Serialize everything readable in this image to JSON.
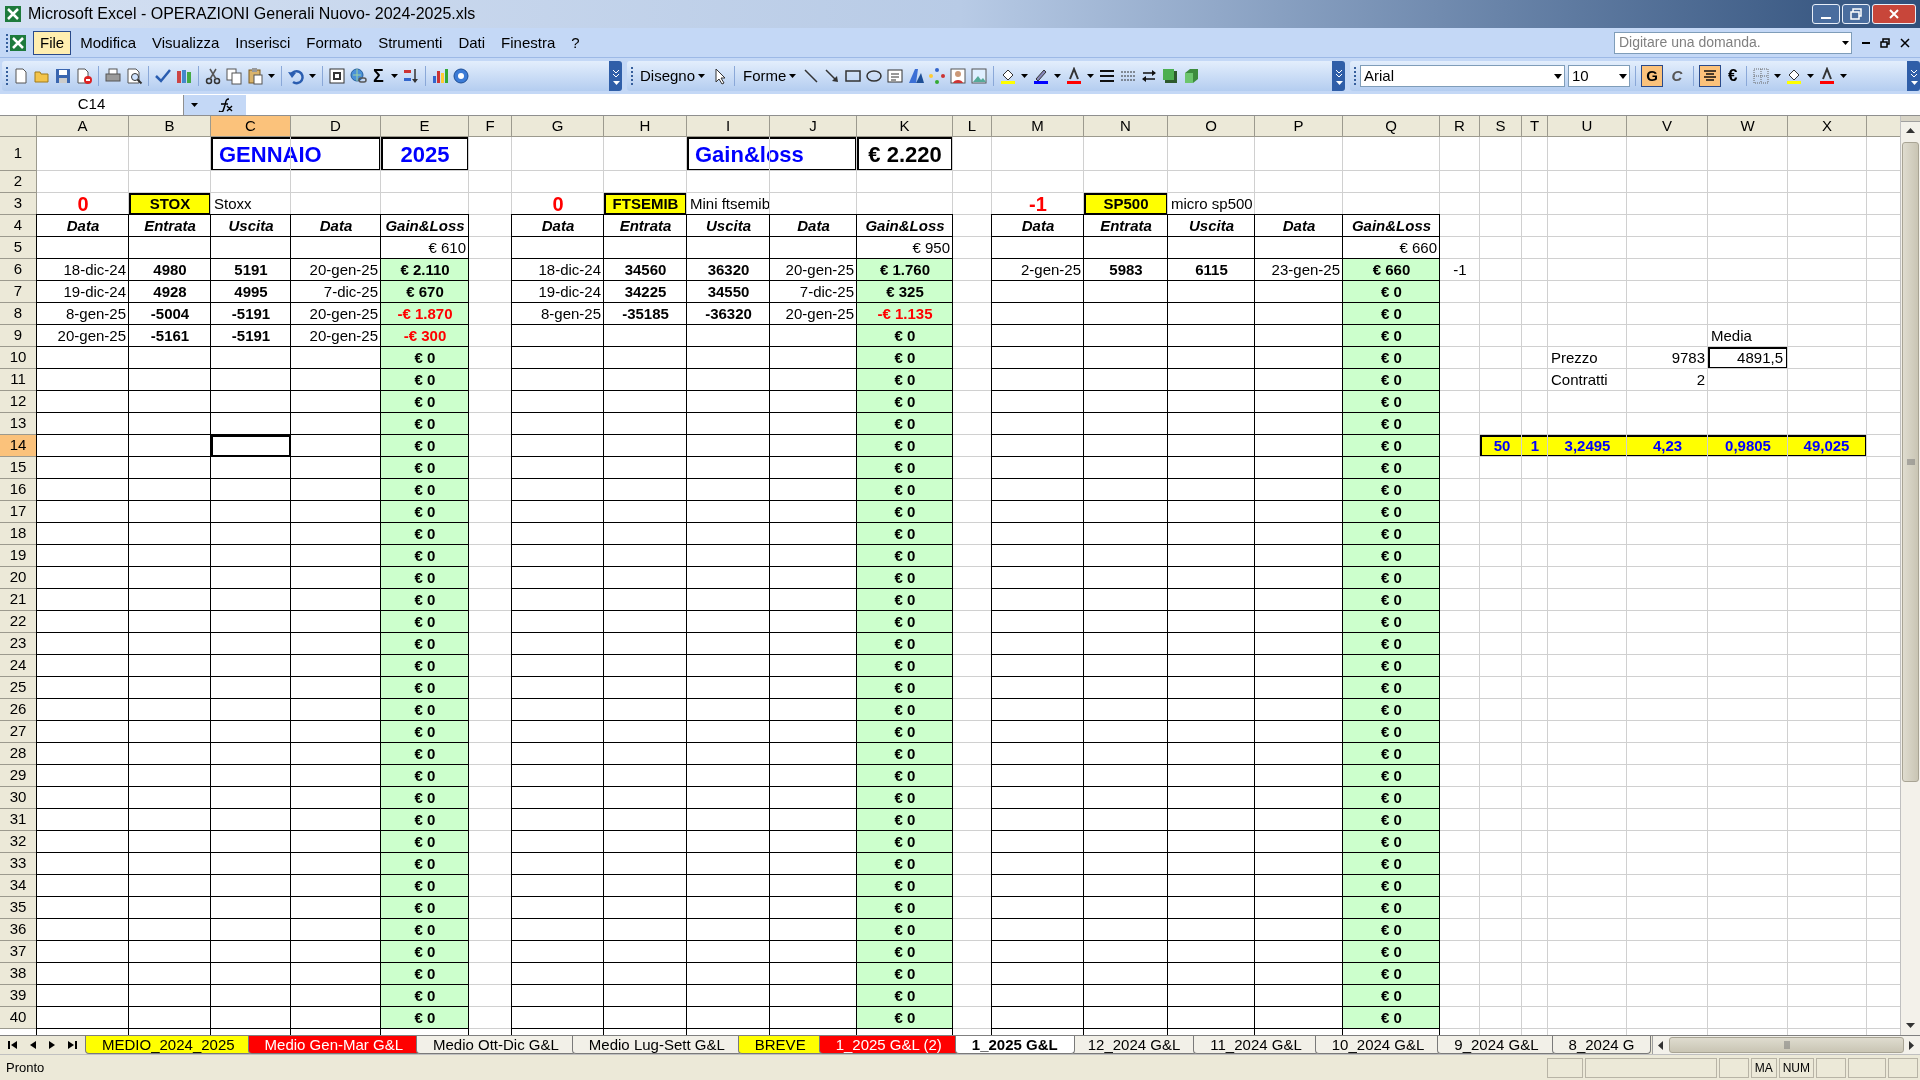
{
  "window": {
    "title": "Microsoft Excel - OPERAZIONI Generali Nuovo- 2024-2025.xls"
  },
  "menu": [
    {
      "label": "File",
      "selected": true
    },
    {
      "label": "Modifica",
      "selected": false
    },
    {
      "label": "Visualizza",
      "selected": false
    },
    {
      "label": "Inserisci",
      "selected": false
    },
    {
      "label": "Formato",
      "selected": false
    },
    {
      "label": "Strumenti",
      "selected": false
    },
    {
      "label": "Dati",
      "selected": false
    },
    {
      "label": "Finestra",
      "selected": false
    },
    {
      "label": "?",
      "selected": false
    }
  ],
  "help_box": {
    "placeholder": "Digitare una domanda."
  },
  "toolbar": {
    "sum": "Σ",
    "drawing_menu": "Disegno",
    "shapes_menu": "Forme",
    "font": "Arial",
    "size": "10",
    "bold": {
      "label": "G",
      "on": true
    },
    "italic": {
      "label": "C",
      "on": false
    },
    "center_align": {
      "on": true
    },
    "euro": "€"
  },
  "formula_bar": {
    "name_box": "C14"
  },
  "sheet": {
    "columns": [
      {
        "label": "A",
        "selected": false
      },
      {
        "label": "B",
        "selected": false
      },
      {
        "label": "C",
        "selected": true
      },
      {
        "label": "D",
        "selected": false
      },
      {
        "label": "E",
        "selected": false
      },
      {
        "label": "F",
        "selected": false
      },
      {
        "label": "G",
        "selected": false
      },
      {
        "label": "H",
        "selected": false
      },
      {
        "label": "I",
        "selected": false
      },
      {
        "label": "J",
        "selected": false
      },
      {
        "label": "K",
        "selected": false
      },
      {
        "label": "L",
        "selected": false
      },
      {
        "label": "M",
        "selected": false
      },
      {
        "label": "N",
        "selected": false
      },
      {
        "label": "O",
        "selected": false
      },
      {
        "label": "P",
        "selected": false
      },
      {
        "label": "Q",
        "selected": false
      },
      {
        "label": "R",
        "selected": false
      },
      {
        "label": "S",
        "selected": false
      },
      {
        "label": "T",
        "selected": false
      },
      {
        "label": "U",
        "selected": false
      },
      {
        "label": "V",
        "selected": false
      },
      {
        "label": "W",
        "selected": false
      },
      {
        "label": "X",
        "selected": false
      }
    ],
    "rows": [
      {
        "label": "1",
        "selected": false,
        "cells": [
          null,
          null,
          {
            "text": "GENNAIO",
            "kind": "merged_title"
          },
          null,
          {
            "text": "2025",
            "kind": "title"
          },
          null,
          null,
          null,
          {
            "text": "Gain&loss",
            "kind": "merged_title"
          },
          null,
          {
            "text": "€ 2.220",
            "kind": "total"
          }
        ]
      },
      {
        "label": "2",
        "selected": false
      },
      {
        "label": "3",
        "selected": false,
        "cells": [
          {
            "text": "0",
            "kind": "count"
          },
          {
            "text": "STOX",
            "kind": "tag"
          },
          {
            "text": "Stoxx",
            "kind": "note"
          },
          null,
          null,
          null,
          {
            "text": "0",
            "kind": "count"
          },
          {
            "text": "FTSEMIB",
            "kind": "tag"
          },
          {
            "text": "Mini ftsemib",
            "kind": "note"
          },
          null,
          null,
          null,
          {
            "text": "-1",
            "kind": "count"
          },
          {
            "text": "SP500",
            "kind": "tag"
          },
          {
            "text": "micro sp500",
            "kind": "note"
          }
        ]
      },
      {
        "label": "4",
        "selected": false,
        "cells": [
          {
            "text": "Data",
            "kind": "header"
          },
          {
            "text": "Entrata",
            "kind": "header"
          },
          {
            "text": "Uscita",
            "kind": "header"
          },
          {
            "text": "Data",
            "kind": "header"
          },
          {
            "text": "Gain&Loss",
            "kind": "header"
          },
          null,
          {
            "text": "Data",
            "kind": "header"
          },
          {
            "text": "Entrata",
            "kind": "header"
          },
          {
            "text": "Uscita",
            "kind": "header"
          },
          {
            "text": "Data",
            "kind": "header"
          },
          {
            "text": "Gain&Loss",
            "kind": "header"
          },
          null,
          {
            "text": "Data",
            "kind": "header"
          },
          {
            "text": "Entrata",
            "kind": "header"
          },
          {
            "text": "Uscita",
            "kind": "header"
          },
          {
            "text": "Data",
            "kind": "header"
          },
          {
            "text": "Gain&Loss",
            "kind": "header"
          }
        ]
      },
      {
        "label": "5",
        "selected": false,
        "cells": [
          null,
          null,
          null,
          null,
          {
            "text": "€ 610",
            "kind": "sum"
          },
          null,
          null,
          null,
          null,
          null,
          {
            "text": "€ 950",
            "kind": "sum"
          },
          null,
          null,
          null,
          null,
          null,
          {
            "text": "€ 660",
            "kind": "sum"
          }
        ]
      },
      {
        "label": "6",
        "selected": false,
        "cells": [
          {
            "text": "18-dic-24",
            "kind": "date"
          },
          {
            "text": "4980",
            "kind": "num"
          },
          {
            "text": "5191",
            "kind": "num"
          },
          {
            "text": "20-gen-25",
            "kind": "date"
          },
          {
            "text": "€ 2.110",
            "kind": "gain"
          },
          null,
          {
            "text": "18-dic-24",
            "kind": "date"
          },
          {
            "text": "34560",
            "kind": "num"
          },
          {
            "text": "36320",
            "kind": "num"
          },
          {
            "text": "20-gen-25",
            "kind": "date"
          },
          {
            "text": "€ 1.760",
            "kind": "gain"
          },
          null,
          {
            "text": "2-gen-25",
            "kind": "date"
          },
          {
            "text": "5983",
            "kind": "num"
          },
          {
            "text": "6115",
            "kind": "num"
          },
          {
            "text": "23-gen-25",
            "kind": "date"
          },
          {
            "text": "€ 660",
            "kind": "gain"
          },
          {
            "text": "-1",
            "kind": "plain_center"
          }
        ]
      },
      {
        "label": "7",
        "selected": false,
        "cells": [
          {
            "text": "19-dic-24",
            "kind": "date"
          },
          {
            "text": "4928",
            "kind": "num"
          },
          {
            "text": "4995",
            "kind": "num"
          },
          {
            "text": "7-dic-25",
            "kind": "date"
          },
          {
            "text": "€ 670",
            "kind": "gain"
          },
          null,
          {
            "text": "19-dic-24",
            "kind": "date"
          },
          {
            "text": "34225",
            "kind": "num"
          },
          {
            "text": "34550",
            "kind": "num"
          },
          {
            "text": "7-dic-25",
            "kind": "date"
          },
          {
            "text": "€ 325",
            "kind": "gain"
          },
          null,
          null,
          null,
          null,
          null,
          {
            "text": "€ 0",
            "kind": "gain"
          }
        ]
      },
      {
        "label": "8",
        "selected": false,
        "cells": [
          {
            "text": "8-gen-25",
            "kind": "date"
          },
          {
            "text": "-5004",
            "kind": "num"
          },
          {
            "text": "-5191",
            "kind": "num"
          },
          {
            "text": "20-gen-25",
            "kind": "date"
          },
          {
            "text": "-€ 1.870",
            "kind": "loss"
          },
          null,
          {
            "text": "8-gen-25",
            "kind": "date"
          },
          {
            "text": "-35185",
            "kind": "num"
          },
          {
            "text": "-36320",
            "kind": "num"
          },
          {
            "text": "20-gen-25",
            "kind": "date"
          },
          {
            "text": "-€ 1.135",
            "kind": "loss"
          },
          null,
          null,
          null,
          null,
          null,
          {
            "text": "€ 0",
            "kind": "gain"
          }
        ]
      },
      {
        "label": "9",
        "selected": false,
        "cells": [
          {
            "text": "20-gen-25",
            "kind": "date"
          },
          {
            "text": "-5161",
            "kind": "num"
          },
          {
            "text": "-5191",
            "kind": "num"
          },
          {
            "text": "20-gen-25",
            "kind": "date"
          },
          {
            "text": "-€ 300",
            "kind": "loss"
          },
          null,
          null,
          null,
          null,
          null,
          {
            "text": "€ 0",
            "kind": "gain"
          },
          null,
          null,
          null,
          null,
          null,
          {
            "text": "€ 0",
            "kind": "gain"
          },
          null,
          null,
          null,
          null,
          null,
          {
            "text": "Media",
            "kind": "note"
          }
        ]
      },
      {
        "label": "10",
        "selected": false,
        "cells": [
          null,
          null,
          null,
          null,
          {
            "text": "€ 0",
            "kind": "gain"
          },
          null,
          null,
          null,
          null,
          null,
          {
            "text": "€ 0",
            "kind": "gain"
          },
          null,
          null,
          null,
          null,
          null,
          {
            "text": "€ 0",
            "kind": "gain"
          },
          null,
          null,
          null,
          {
            "text": "Prezzo",
            "kind": "note"
          },
          {
            "text": "9783",
            "kind": "value"
          },
          {
            "text": "4891,5",
            "kind": "boxed"
          }
        ]
      },
      {
        "label": "11",
        "selected": false,
        "cells": [
          null,
          null,
          null,
          null,
          {
            "text": "€ 0",
            "kind": "gain"
          },
          null,
          null,
          null,
          null,
          null,
          {
            "text": "€ 0",
            "kind": "gain"
          },
          null,
          null,
          null,
          null,
          null,
          {
            "text": "€ 0",
            "kind": "gain"
          },
          null,
          null,
          null,
          {
            "text": "Contratti",
            "kind": "note"
          },
          {
            "text": "2",
            "kind": "value"
          }
        ]
      },
      {
        "label": "12",
        "selected": false,
        "cells": [
          null,
          null,
          null,
          null,
          {
            "text": "€ 0",
            "kind": "gain"
          },
          null,
          null,
          null,
          null,
          null,
          {
            "text": "€ 0",
            "kind": "gain"
          },
          null,
          null,
          null,
          null,
          null,
          {
            "text": "€ 0",
            "kind": "gain"
          }
        ]
      },
      {
        "label": "13",
        "selected": false,
        "cells": [
          null,
          null,
          null,
          null,
          {
            "text": "€ 0",
            "kind": "gain"
          },
          null,
          null,
          null,
          null,
          null,
          {
            "text": "€ 0",
            "kind": "gain"
          },
          null,
          null,
          null,
          null,
          null,
          {
            "text": "€ 0",
            "kind": "gain"
          }
        ]
      },
      {
        "label": "14",
        "selected": true,
        "cells": [
          null,
          null,
          null,
          null,
          {
            "text": "€ 0",
            "kind": "gain"
          },
          null,
          null,
          null,
          null,
          null,
          {
            "text": "€ 0",
            "kind": "gain"
          },
          null,
          null,
          null,
          null,
          null,
          {
            "text": "€ 0",
            "kind": "gain"
          },
          null,
          {
            "text": "50",
            "kind": "highlight"
          },
          {
            "text": "1",
            "kind": "highlight"
          },
          {
            "text": "3,2495",
            "kind": "highlight"
          },
          {
            "text": "4,23",
            "kind": "highlight"
          },
          {
            "text": "0,9805",
            "kind": "highlight"
          },
          {
            "text": "49,025",
            "kind": "highlight"
          }
        ]
      },
      {
        "label": "15",
        "selected": false,
        "cells": [
          null,
          null,
          null,
          null,
          {
            "text": "€ 0",
            "kind": "gain"
          },
          null,
          null,
          null,
          null,
          null,
          {
            "text": "€ 0",
            "kind": "gain"
          },
          null,
          null,
          null,
          null,
          null,
          {
            "text": "€ 0",
            "kind": "gain"
          }
        ]
      },
      {
        "label": "16",
        "selected": false,
        "cells": [
          null,
          null,
          null,
          null,
          {
            "text": "€ 0",
            "kind": "gain"
          },
          null,
          null,
          null,
          null,
          null,
          {
            "text": "€ 0",
            "kind": "gain"
          },
          null,
          null,
          null,
          null,
          null,
          {
            "text": "€ 0",
            "kind": "gain"
          }
        ]
      },
      {
        "label": "17",
        "selected": false,
        "cells": [
          null,
          null,
          null,
          null,
          {
            "text": "€ 0",
            "kind": "gain"
          },
          null,
          null,
          null,
          null,
          null,
          {
            "text": "€ 0",
            "kind": "gain"
          },
          null,
          null,
          null,
          null,
          null,
          {
            "text": "€ 0",
            "kind": "gain"
          }
        ]
      },
      {
        "label": "18",
        "selected": false,
        "cells": [
          null,
          null,
          null,
          null,
          {
            "text": "€ 0",
            "kind": "gain"
          },
          null,
          null,
          null,
          null,
          null,
          {
            "text": "€ 0",
            "kind": "gain"
          },
          null,
          null,
          null,
          null,
          null,
          {
            "text": "€ 0",
            "kind": "gain"
          }
        ]
      },
      {
        "label": "19",
        "selected": false,
        "cells": [
          null,
          null,
          null,
          null,
          {
            "text": "€ 0",
            "kind": "gain"
          },
          null,
          null,
          null,
          null,
          null,
          {
            "text": "€ 0",
            "kind": "gain"
          },
          null,
          null,
          null,
          null,
          null,
          {
            "text": "€ 0",
            "kind": "gain"
          }
        ]
      },
      {
        "label": "20",
        "selected": false,
        "cells": [
          null,
          null,
          null,
          null,
          {
            "text": "€ 0",
            "kind": "gain"
          },
          null,
          null,
          null,
          null,
          null,
          {
            "text": "€ 0",
            "kind": "gain"
          },
          null,
          null,
          null,
          null,
          null,
          {
            "text": "€ 0",
            "kind": "gain"
          }
        ]
      },
      {
        "label": "21",
        "selected": false,
        "cells": [
          null,
          null,
          null,
          null,
          {
            "text": "€ 0",
            "kind": "gain"
          },
          null,
          null,
          null,
          null,
          null,
          {
            "text": "€ 0",
            "kind": "gain"
          },
          null,
          null,
          null,
          null,
          null,
          {
            "text": "€ 0",
            "kind": "gain"
          }
        ]
      },
      {
        "label": "22",
        "selected": false,
        "cells": [
          null,
          null,
          null,
          null,
          {
            "text": "€ 0",
            "kind": "gain"
          },
          null,
          null,
          null,
          null,
          null,
          {
            "text": "€ 0",
            "kind": "gain"
          },
          null,
          null,
          null,
          null,
          null,
          {
            "text": "€ 0",
            "kind": "gain"
          }
        ]
      },
      {
        "label": "23",
        "selected": false,
        "cells": [
          null,
          null,
          null,
          null,
          {
            "text": "€ 0",
            "kind": "gain"
          },
          null,
          null,
          null,
          null,
          null,
          {
            "text": "€ 0",
            "kind": "gain"
          },
          null,
          null,
          null,
          null,
          null,
          {
            "text": "€ 0",
            "kind": "gain"
          }
        ]
      },
      {
        "label": "24",
        "selected": false,
        "cells": [
          null,
          null,
          null,
          null,
          {
            "text": "€ 0",
            "kind": "gain"
          },
          null,
          null,
          null,
          null,
          null,
          {
            "text": "€ 0",
            "kind": "gain"
          },
          null,
          null,
          null,
          null,
          null,
          {
            "text": "€ 0",
            "kind": "gain"
          }
        ]
      },
      {
        "label": "25",
        "selected": false,
        "cells": [
          null,
          null,
          null,
          null,
          {
            "text": "€ 0",
            "kind": "gain"
          },
          null,
          null,
          null,
          null,
          null,
          {
            "text": "€ 0",
            "kind": "gain"
          },
          null,
          null,
          null,
          null,
          null,
          {
            "text": "€ 0",
            "kind": "gain"
          }
        ]
      },
      {
        "label": "26",
        "selected": false,
        "cells": [
          null,
          null,
          null,
          null,
          {
            "text": "€ 0",
            "kind": "gain"
          },
          null,
          null,
          null,
          null,
          null,
          {
            "text": "€ 0",
            "kind": "gain"
          },
          null,
          null,
          null,
          null,
          null,
          {
            "text": "€ 0",
            "kind": "gain"
          }
        ]
      },
      {
        "label": "27",
        "selected": false,
        "cells": [
          null,
          null,
          null,
          null,
          {
            "text": "€ 0",
            "kind": "gain"
          },
          null,
          null,
          null,
          null,
          null,
          {
            "text": "€ 0",
            "kind": "gain"
          },
          null,
          null,
          null,
          null,
          null,
          {
            "text": "€ 0",
            "kind": "gain"
          }
        ]
      },
      {
        "label": "28",
        "selected": false,
        "cells": [
          null,
          null,
          null,
          null,
          {
            "text": "€ 0",
            "kind": "gain"
          },
          null,
          null,
          null,
          null,
          null,
          {
            "text": "€ 0",
            "kind": "gain"
          },
          null,
          null,
          null,
          null,
          null,
          {
            "text": "€ 0",
            "kind": "gain"
          }
        ]
      },
      {
        "label": "29",
        "selected": false,
        "cells": [
          null,
          null,
          null,
          null,
          {
            "text": "€ 0",
            "kind": "gain"
          },
          null,
          null,
          null,
          null,
          null,
          {
            "text": "€ 0",
            "kind": "gain"
          },
          null,
          null,
          null,
          null,
          null,
          {
            "text": "€ 0",
            "kind": "gain"
          }
        ]
      },
      {
        "label": "30",
        "selected": false,
        "cells": [
          null,
          null,
          null,
          null,
          {
            "text": "€ 0",
            "kind": "gain"
          },
          null,
          null,
          null,
          null,
          null,
          {
            "text": "€ 0",
            "kind": "gain"
          },
          null,
          null,
          null,
          null,
          null,
          {
            "text": "€ 0",
            "kind": "gain"
          }
        ]
      },
      {
        "label": "31",
        "selected": false,
        "cells": [
          null,
          null,
          null,
          null,
          {
            "text": "€ 0",
            "kind": "gain"
          },
          null,
          null,
          null,
          null,
          null,
          {
            "text": "€ 0",
            "kind": "gain"
          },
          null,
          null,
          null,
          null,
          null,
          {
            "text": "€ 0",
            "kind": "gain"
          }
        ]
      },
      {
        "label": "32",
        "selected": false,
        "cells": [
          null,
          null,
          null,
          null,
          {
            "text": "€ 0",
            "kind": "gain"
          },
          null,
          null,
          null,
          null,
          null,
          {
            "text": "€ 0",
            "kind": "gain"
          },
          null,
          null,
          null,
          null,
          null,
          {
            "text": "€ 0",
            "kind": "gain"
          }
        ]
      },
      {
        "label": "33",
        "selected": false,
        "cells": [
          null,
          null,
          null,
          null,
          {
            "text": "€ 0",
            "kind": "gain"
          },
          null,
          null,
          null,
          null,
          null,
          {
            "text": "€ 0",
            "kind": "gain"
          },
          null,
          null,
          null,
          null,
          null,
          {
            "text": "€ 0",
            "kind": "gain"
          }
        ]
      },
      {
        "label": "34",
        "selected": false,
        "cells": [
          null,
          null,
          null,
          null,
          {
            "text": "€ 0",
            "kind": "gain"
          },
          null,
          null,
          null,
          null,
          null,
          {
            "text": "€ 0",
            "kind": "gain"
          },
          null,
          null,
          null,
          null,
          null,
          {
            "text": "€ 0",
            "kind": "gain"
          }
        ]
      },
      {
        "label": "35",
        "selected": false,
        "cells": [
          null,
          null,
          null,
          null,
          {
            "text": "€ 0",
            "kind": "gain"
          },
          null,
          null,
          null,
          null,
          null,
          {
            "text": "€ 0",
            "kind": "gain"
          },
          null,
          null,
          null,
          null,
          null,
          {
            "text": "€ 0",
            "kind": "gain"
          }
        ]
      },
      {
        "label": "36",
        "selected": false,
        "cells": [
          null,
          null,
          null,
          null,
          {
            "text": "€ 0",
            "kind": "gain"
          },
          null,
          null,
          null,
          null,
          null,
          {
            "text": "€ 0",
            "kind": "gain"
          },
          null,
          null,
          null,
          null,
          null,
          {
            "text": "€ 0",
            "kind": "gain"
          }
        ]
      },
      {
        "label": "37",
        "selected": false,
        "cells": [
          null,
          null,
          null,
          null,
          {
            "text": "€ 0",
            "kind": "gain"
          },
          null,
          null,
          null,
          null,
          null,
          {
            "text": "€ 0",
            "kind": "gain"
          },
          null,
          null,
          null,
          null,
          null,
          {
            "text": "€ 0",
            "kind": "gain"
          }
        ]
      },
      {
        "label": "38",
        "selected": false,
        "cells": [
          null,
          null,
          null,
          null,
          {
            "text": "€ 0",
            "kind": "gain"
          },
          null,
          null,
          null,
          null,
          null,
          {
            "text": "€ 0",
            "kind": "gain"
          },
          null,
          null,
          null,
          null,
          null,
          {
            "text": "€ 0",
            "kind": "gain"
          }
        ]
      },
      {
        "label": "39",
        "selected": false,
        "cells": [
          null,
          null,
          null,
          null,
          {
            "text": "€ 0",
            "kind": "gain"
          },
          null,
          null,
          null,
          null,
          null,
          {
            "text": "€ 0",
            "kind": "gain"
          },
          null,
          null,
          null,
          null,
          null,
          {
            "text": "€ 0",
            "kind": "gain"
          }
        ]
      },
      {
        "label": "40",
        "selected": false,
        "cells": [
          null,
          null,
          null,
          null,
          {
            "text": "€ 0",
            "kind": "gain"
          },
          null,
          null,
          null,
          null,
          null,
          {
            "text": "€ 0",
            "kind": "gain"
          },
          null,
          null,
          null,
          null,
          null,
          {
            "text": "€ 0",
            "kind": "gain"
          }
        ]
      }
    ]
  },
  "sheet_tabs": [
    {
      "label": "MEDIO_2024_2025",
      "color": "#ffff00",
      "selected": false
    },
    {
      "label": "Medio Gen-Mar G&L",
      "color": "#ff0000",
      "selected": false
    },
    {
      "label": "Medio Ott-Dic G&L",
      "selected": false
    },
    {
      "label": "Medio Lug-Sett G&L",
      "selected": false
    },
    {
      "label": "BREVE",
      "color": "#ffff00",
      "selected": false
    },
    {
      "label": "1_2025 G&L (2)",
      "color": "#ff0000",
      "selected": false
    },
    {
      "label": "1_2025 G&L",
      "selected": true
    },
    {
      "label": "12_2024 G&L",
      "selected": false
    },
    {
      "label": "11_2024 G&L",
      "selected": false
    },
    {
      "label": "10_2024 G&L",
      "selected": false
    },
    {
      "label": "9_2024 G&L",
      "selected": false
    },
    {
      "label": "8_2024 G",
      "selected": false
    }
  ],
  "status_bar": {
    "text": "Pronto",
    "indicators": [
      "MA",
      "NUM"
    ]
  }
}
